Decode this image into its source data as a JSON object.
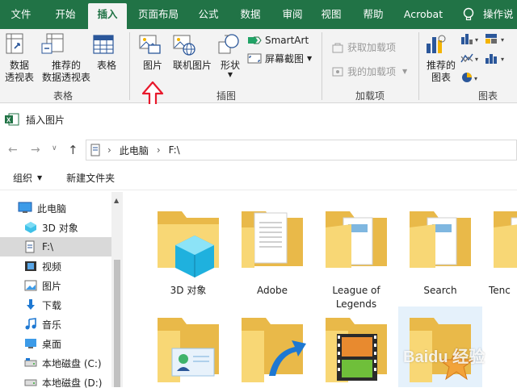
{
  "ribbon_tabs": [
    "文件",
    "开始",
    "插入",
    "页面布局",
    "公式",
    "数据",
    "审阅",
    "视图",
    "帮助",
    "Acrobat",
    "操作说"
  ],
  "active_tab": "插入",
  "ribbon": {
    "pivot": "数据\n透视表",
    "recommended_pivot": "推荐的\n数据透视表",
    "table": "表格",
    "group_tables": "表格",
    "picture": "图片",
    "online_picture": "联机图片",
    "shapes": "形状",
    "smartart": "SmartArt",
    "screenshot": "屏幕截图",
    "group_illustrations": "插图",
    "get_addins": "获取加载项",
    "my_addins": "我的加载项",
    "group_addins": "加载项",
    "recommended_charts": "推荐的\n图表",
    "group_charts": "图表"
  },
  "dialog": {
    "title": "插入图片",
    "address": [
      "此电脑",
      "F:\\"
    ],
    "organize": "组织",
    "new_folder": "新建文件夹"
  },
  "nav_tree": [
    "此电脑",
    "3D 对象",
    "F:\\",
    "视频",
    "图片",
    "下载",
    "音乐",
    "桌面",
    "本地磁盘 (C:)",
    "本地磁盘 (D:)"
  ],
  "selected_tree": "F:\\",
  "files": [
    {
      "name": "3D 对象",
      "kind": "3d"
    },
    {
      "name": "Adobe",
      "kind": "doc"
    },
    {
      "name": "League of\nLegends",
      "kind": "docs"
    },
    {
      "name": "Search",
      "kind": "docs"
    },
    {
      "name": "Tenc",
      "kind": "plain"
    },
    {
      "name": "",
      "kind": "contact"
    },
    {
      "name": "",
      "kind": "link"
    },
    {
      "name": "",
      "kind": "video"
    },
    {
      "name": "",
      "kind": "star"
    }
  ],
  "watermark": "Baidu 经验",
  "colors": {
    "excel_green": "#217346",
    "folder": "#f8d775",
    "folder_dark": "#e9b949",
    "accent": "#0078d4",
    "arrow_red": "#e8192c"
  }
}
